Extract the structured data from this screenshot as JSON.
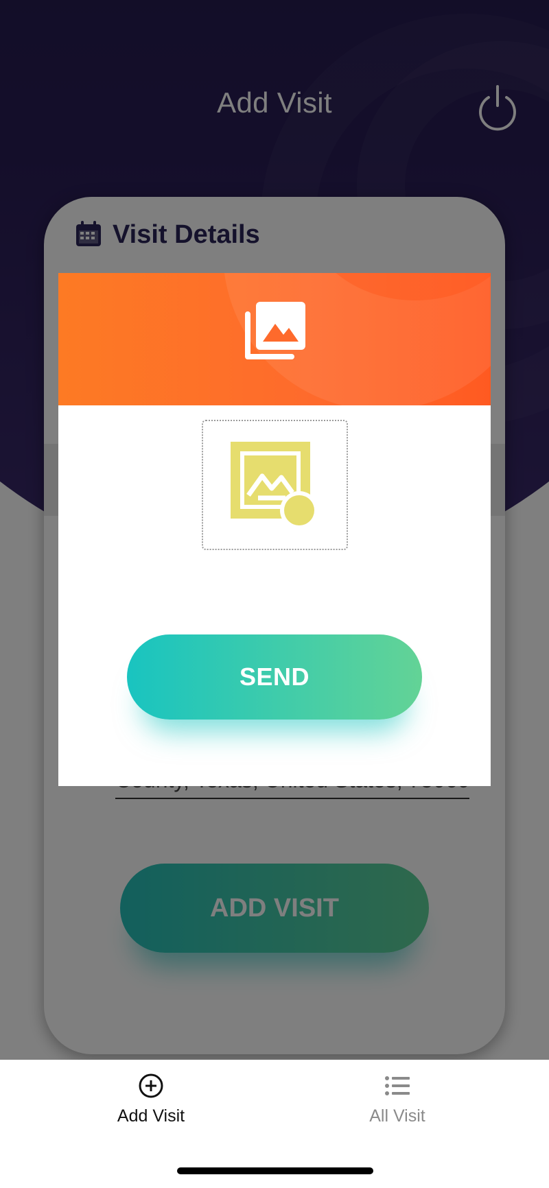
{
  "header": {
    "title": "Add Visit",
    "power_icon": "power-icon"
  },
  "card": {
    "title": "Visit Details",
    "title_icon": "calendar-icon",
    "address_value": "County, Texas, United States, 75060",
    "submit_label": "ADD VISIT"
  },
  "dialog": {
    "header_icon": "photo-library-icon",
    "picker_icon": "add-photo-icon",
    "send_label": "SEND"
  },
  "bottom_nav": {
    "items": [
      {
        "label": "Add Visit",
        "icon": "add-circle-icon",
        "active": true
      },
      {
        "label": "All Visit",
        "icon": "list-icon",
        "active": false
      }
    ]
  },
  "colors": {
    "header_purple": "#231b4d",
    "dialog_orange": "#fe6a2c",
    "button_teal": "#19c4c0",
    "button_green": "#63d396",
    "placeholder_yellow": "#e6dd6e"
  }
}
